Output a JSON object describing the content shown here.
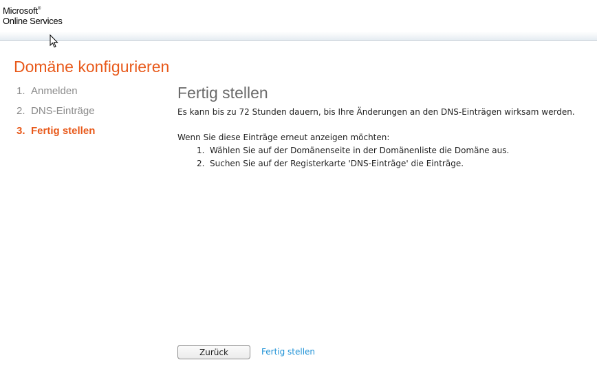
{
  "header": {
    "brand_line1": "Microsoft",
    "brand_line2": "Online Services"
  },
  "page": {
    "title": "Domäne konfigurieren"
  },
  "steps": [
    {
      "number": "1.",
      "label": "Anmelden",
      "active": false
    },
    {
      "number": "2.",
      "label": "DNS-Einträge",
      "active": false
    },
    {
      "number": "3.",
      "label": "Fertig stellen",
      "active": true
    }
  ],
  "content": {
    "title": "Fertig stellen",
    "paragraph1": "Es kann bis zu 72 Stunden dauern, bis Ihre Änderungen an den DNS-Einträgen wirksam werden.",
    "paragraph2": "Wenn Sie diese Einträge erneut anzeigen möchten:",
    "instructions": [
      {
        "number": "1.",
        "text": "Wählen Sie auf der Domänenseite in der Domänenliste die Domäne aus."
      },
      {
        "number": "2.",
        "text": "Suchen Sie auf der Registerkarte 'DNS-Einträge' die Einträge."
      }
    ]
  },
  "actions": {
    "back_label": "Zurück",
    "finish_label": "Fertig stellen"
  },
  "colors": {
    "accent": "#e8591a",
    "link": "#1e91d6",
    "muted": "#8a8a8a"
  }
}
